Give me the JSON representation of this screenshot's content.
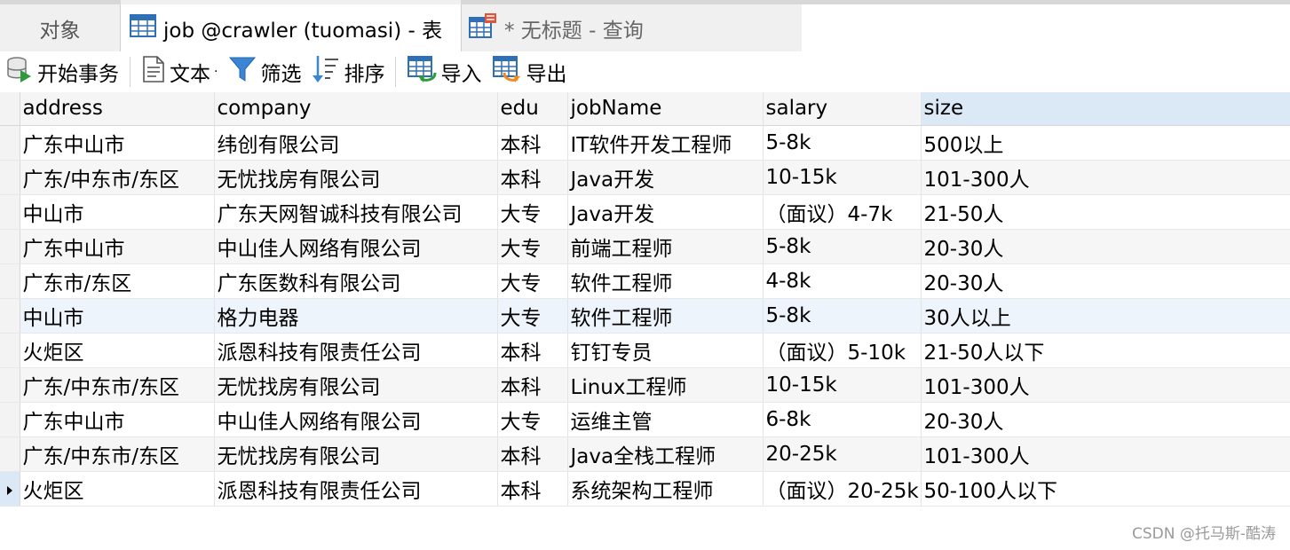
{
  "tabs": {
    "objects": "对象",
    "table": "job @crawler (tuomasi) - 表",
    "query": "* 无标题 - 查询"
  },
  "toolbar": {
    "begin_transaction": "开始事务",
    "text": "文本",
    "filter": "筛选",
    "sort": "排序",
    "import": "导入",
    "export": "导出"
  },
  "grid": {
    "columns": [
      "address",
      "company",
      "edu",
      "jobName",
      "salary",
      "size"
    ],
    "rows": [
      [
        "广东中山市",
        "纬创有限公司",
        "本科",
        "IT软件开发工程师",
        "5-8k",
        "500以上"
      ],
      [
        "广东/中东市/东区",
        "无忧找房有限公司",
        "本科",
        "Java开发",
        "10-15k",
        "101-300人"
      ],
      [
        "中山市",
        "广东天网智诚科技有限公司",
        "大专",
        "Java开发",
        "（面议）4-7k",
        "21-50人"
      ],
      [
        "广东中山市",
        "中山佳人网络有限公司",
        "大专",
        "前端工程师",
        "5-8k",
        "20-30人"
      ],
      [
        "广东市/东区",
        "广东医数科有限公司",
        "大专",
        "软件工程师",
        "4-8k",
        "20-30人"
      ],
      [
        "中山市",
        "格力电器",
        "大专",
        "软件工程师",
        "5-8k",
        "30人以上"
      ],
      [
        "火炬区",
        "派恩科技有限责任公司",
        "本科",
        "钉钉专员",
        "（面议）5-10k",
        "21-50人以下"
      ],
      [
        "广东/中东市/东区",
        "无忧找房有限公司",
        "本科",
        "Linux工程师",
        "10-15k",
        "101-300人"
      ],
      [
        "广东中山市",
        "中山佳人网络有限公司",
        "大专",
        "运维主管",
        "6-8k",
        "20-30人"
      ],
      [
        "广东/中东市/东区",
        "无忧找房有限公司",
        "本科",
        "Java全栈工程师",
        "20-25k",
        "101-300人"
      ],
      [
        "火炬区",
        "派恩科技有限责任公司",
        "本科",
        "系统架构工程师",
        "（面议）20-25k",
        "50-100人以下"
      ]
    ]
  },
  "watermark": "CSDN @托马斯-酷涛",
  "colors": {
    "selected_header": "#dbe8f6",
    "tab_strip": "#f0f0f0",
    "accent_blue": "#2f6fb5"
  }
}
